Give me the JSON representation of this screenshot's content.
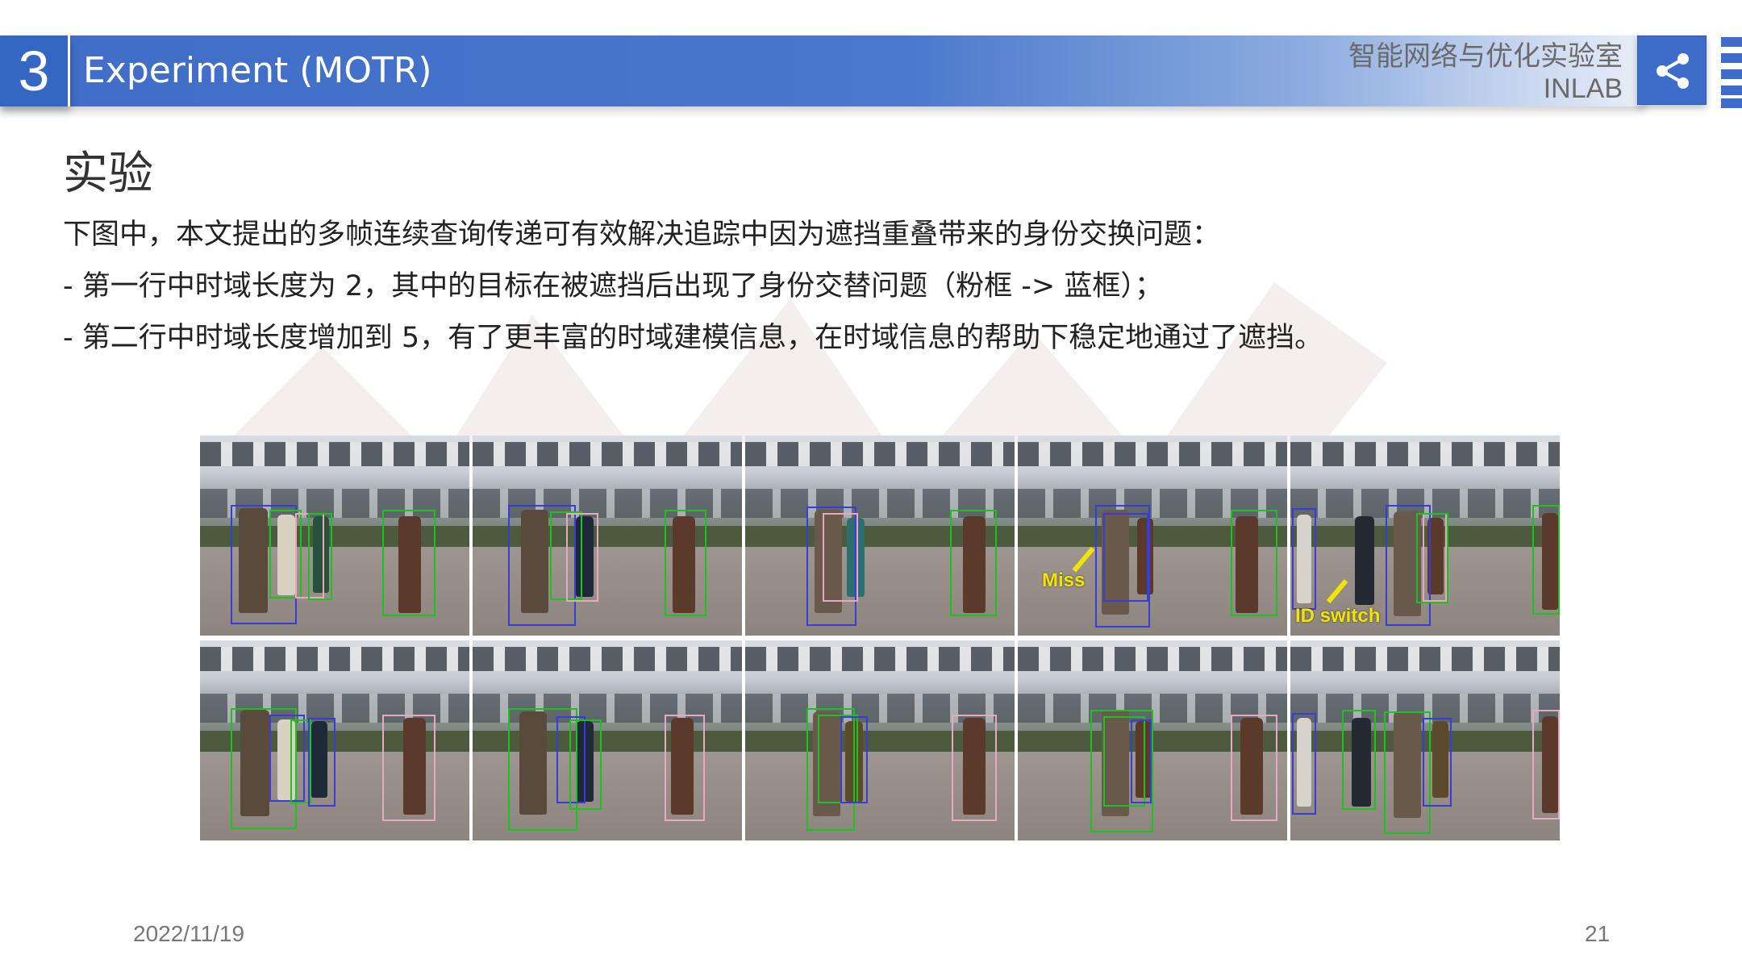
{
  "header": {
    "section_number": "3",
    "title": "Experiment (MOTR)",
    "lab_name_cn": "智能网络与优化实验室",
    "lab_name_en": "INLAB"
  },
  "icons": {
    "share": "share-icon"
  },
  "content": {
    "heading": "实验",
    "paragraphs": [
      "下图中，本文提出的多帧连续查询传递可有效解决追踪中因为遮挡重叠带来的身份交换问题：",
      "- 第一行中时域长度为 2，其中的目标在被遮挡后出现了身份交替问题（粉框 -> 蓝框）；",
      "- 第二行中时域长度增加到 5，有了更丰富的时域建模信息，在时域信息的帮助下稳定地通过了遮挡。"
    ]
  },
  "figure": {
    "annotations": {
      "miss": "Miss",
      "id_switch": "ID switch"
    },
    "colors": {
      "blue_box": "#3b3bd6",
      "green_box": "#20c020",
      "pink_box": "#e7a9c0",
      "annotation": "#f5e400"
    }
  },
  "footer": {
    "date": "2022/11/19",
    "page_number": "21"
  }
}
